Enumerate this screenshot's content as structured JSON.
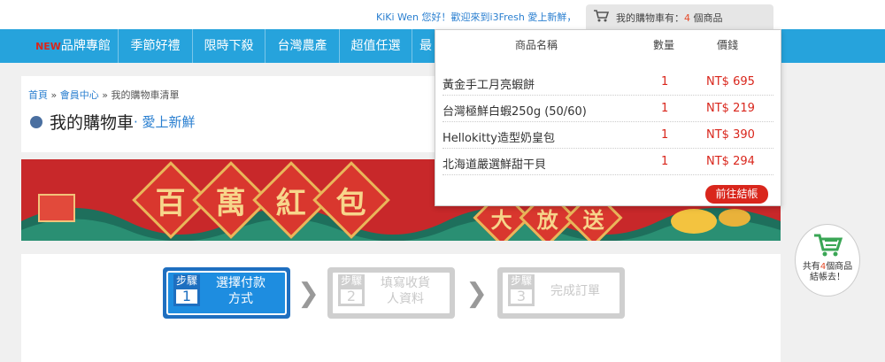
{
  "header": {
    "user_name": "KiKi Wen",
    "greeting": " 您好！歡迎來到i3Fresh 愛上新鮮，",
    "cart_tab_prefix": "我的購物車有：",
    "cart_count": "4",
    "cart_tab_suffix": " 個商品"
  },
  "nav": {
    "new_badge": "NEW",
    "items": [
      "品牌專館",
      "季節好禮",
      "限時下殺",
      "台灣農產",
      "超值任選",
      "最"
    ]
  },
  "breadcrumb": {
    "home": "首頁",
    "sep": " » ",
    "member": "會員中心",
    "current": "我的購物車清單"
  },
  "page": {
    "title": "我的購物車",
    "subtitle": "· 愛上新鮮"
  },
  "banner": {
    "chars": [
      "百",
      "萬",
      "紅",
      "包"
    ],
    "chars_right": [
      "大",
      "放",
      "送"
    ]
  },
  "steps": [
    {
      "badge": "步驟",
      "num": "1",
      "label": "選擇付款\n方式",
      "active": true
    },
    {
      "badge": "步驟",
      "num": "2",
      "label": "填寫收貨\n人資料",
      "active": false
    },
    {
      "badge": "步驟",
      "num": "3",
      "label": "完成訂單",
      "active": false
    }
  ],
  "cart_dropdown": {
    "col_name": "商品名稱",
    "col_qty": "數量",
    "col_price": "價錢",
    "items": [
      {
        "name": "黃金手工月亮蝦餅",
        "qty": "1",
        "price": "NT$ 695"
      },
      {
        "name": "台灣極鮮白蝦250g (50/60)",
        "qty": "1",
        "price": "NT$ 219"
      },
      {
        "name": "Hellokitty造型奶皇包",
        "qty": "1",
        "price": "NT$ 390"
      },
      {
        "name": "北海道嚴選鮮甜干貝",
        "qty": "1",
        "price": "NT$ 294"
      }
    ],
    "checkout_label": "前往結帳"
  },
  "float_cart": {
    "line1_prefix": "共有",
    "count": "4",
    "line1_suffix": "個商品",
    "line2": "結帳去！"
  },
  "colors": {
    "nav_blue": "#26a3dc",
    "accent_red": "#d9261c",
    "link_blue": "#2a7fd0"
  }
}
